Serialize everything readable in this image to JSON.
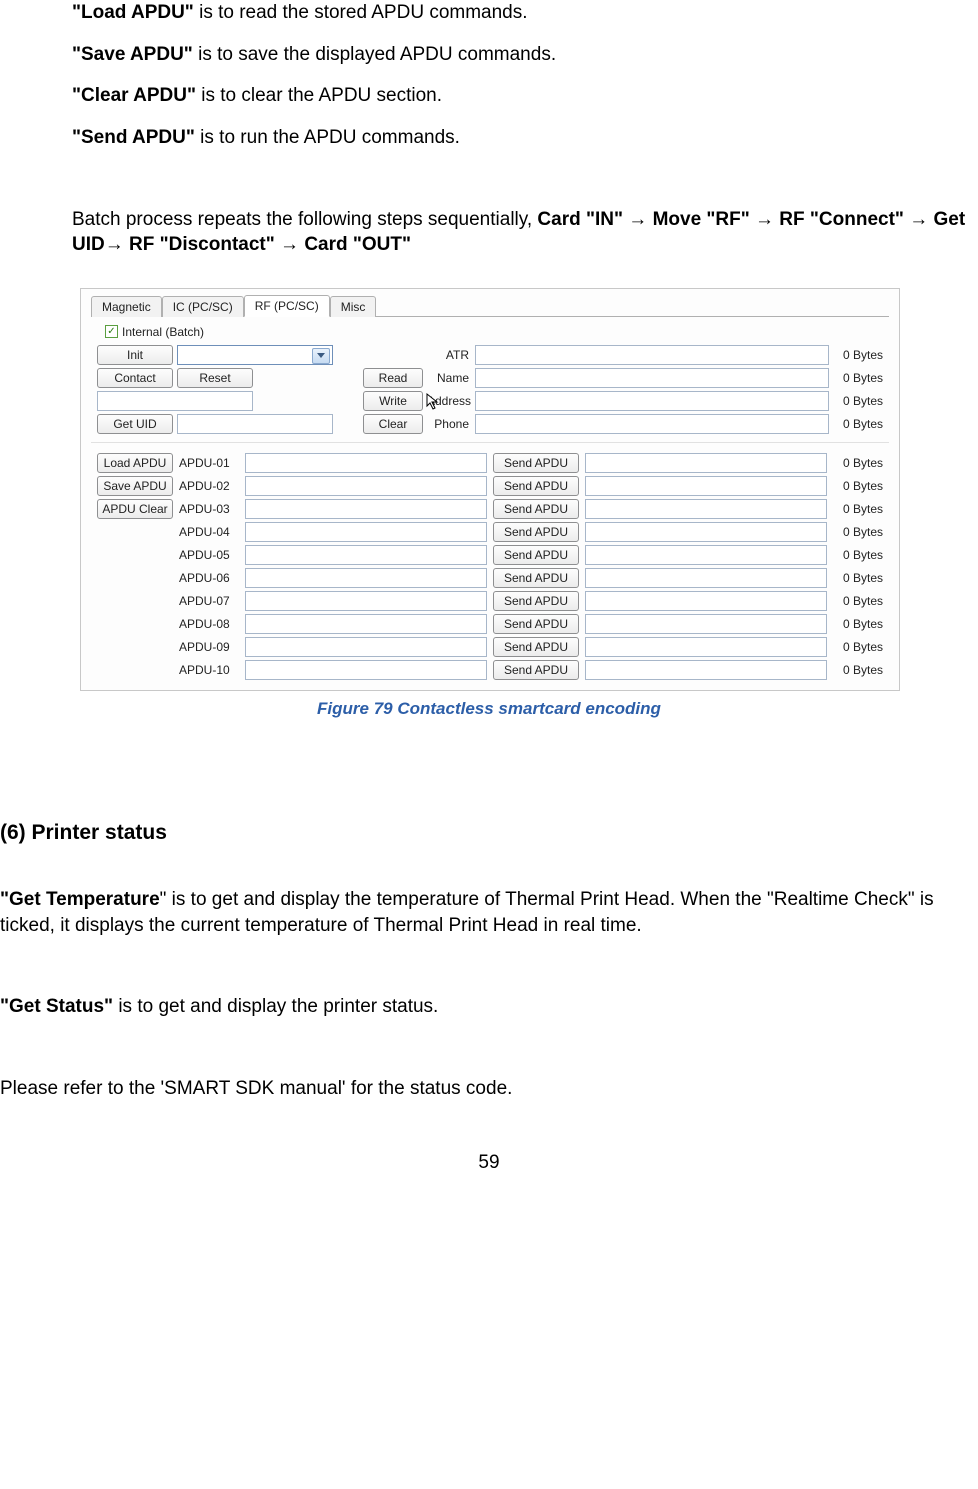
{
  "body": {
    "p1": {
      "b": "\"Load APDU\"",
      "t": " is to read the stored APDU commands."
    },
    "p2": {
      "b": "\"Save APDU\"",
      "t": " is to save the displayed APDU commands."
    },
    "p3": {
      "b": "\"Clear APDU\"",
      "t": " is to clear the APDU section."
    },
    "p4": {
      "b": "\"Send APDU\"",
      "t": " is to run the APDU commands."
    },
    "p5": {
      "a": "Batch process repeats the following steps sequentially, ",
      "b": "Card \"IN\" → Move \"RF\" → RF \"Connect\" → Get UID→ RF \"Discontact\" → Card \"OUT\""
    },
    "caption": "Figure 79 Contactless smartcard encoding",
    "h6": "(6) Printer status",
    "p6a": {
      "b": "\"Get Temperature",
      "t": "\" is to get and display the temperature of Thermal Print Head. When the \"Realtime Check\" is ticked, it displays the current temperature of Thermal Print Head in real time."
    },
    "p7": {
      "b": "\"Get Status\"",
      "t": " is to get and display the printer status."
    },
    "p8": "Please refer to the 'SMART SDK manual' for the status code.",
    "pagenum": "59"
  },
  "ui": {
    "tabs": [
      "Magnetic",
      "IC (PC/SC)",
      "RF (PC/SC)",
      "Misc"
    ],
    "checkbox_label": "Internal (Batch)",
    "buttons": {
      "init": "Init",
      "contact": "Contact",
      "reset": "Reset",
      "getuid": "Get UID",
      "read": "Read",
      "write": "Write",
      "clear": "Clear",
      "load": "Load APDU",
      "save": "Save APDU",
      "apduclear": "APDU Clear",
      "send": "Send APDU"
    },
    "labels": {
      "atr": "ATR",
      "name": "Name",
      "address": "Address",
      "phone": "Phone"
    },
    "bytes": "0 Bytes",
    "apdu_rows": [
      "APDU-01",
      "APDU-02",
      "APDU-03",
      "APDU-04",
      "APDU-05",
      "APDU-06",
      "APDU-07",
      "APDU-08",
      "APDU-09",
      "APDU-10"
    ]
  }
}
